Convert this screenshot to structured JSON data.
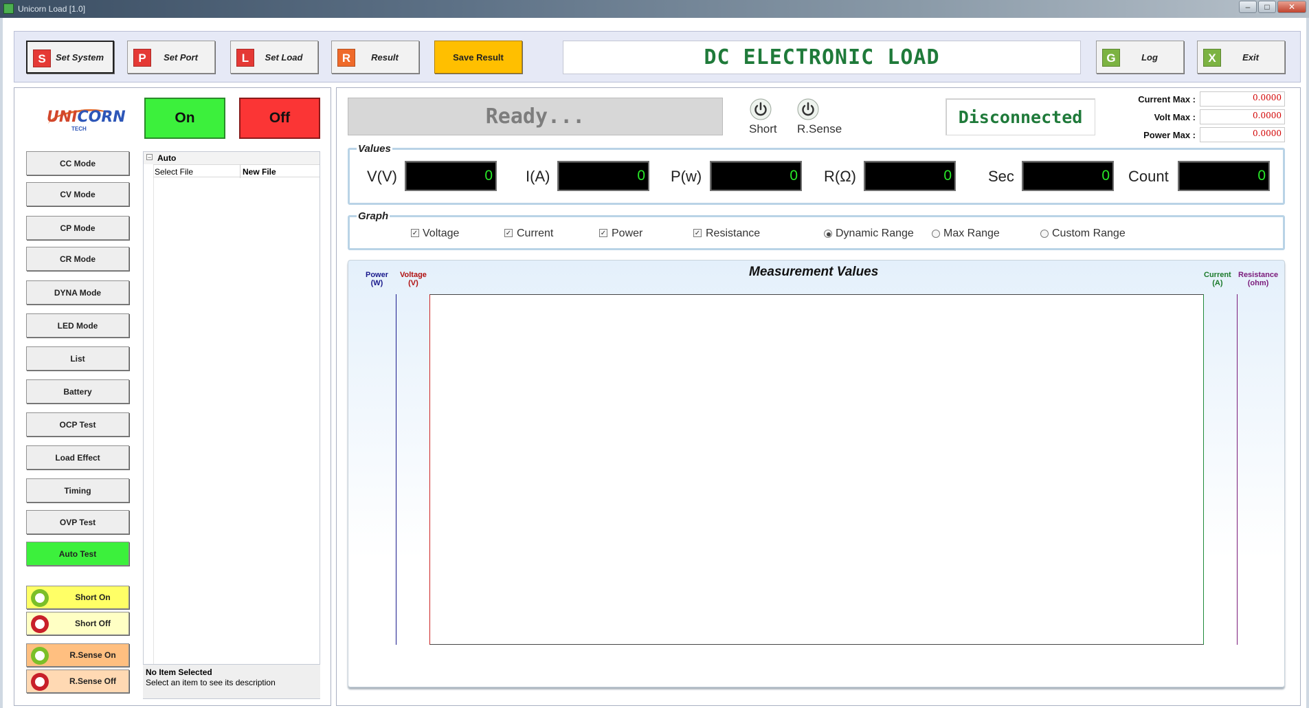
{
  "window": {
    "title": "Unicorn Load [1.0]"
  },
  "toolbar": {
    "set_system": {
      "icon": "S",
      "label": "Set System",
      "color": "#e53935"
    },
    "set_port": {
      "icon": "P",
      "label": "Set Port",
      "color": "#e53935"
    },
    "set_load": {
      "icon": "L",
      "label": "Set Load",
      "color": "#e53935"
    },
    "result": {
      "icon": "R",
      "label": "Result",
      "color": "#ef6a2a"
    },
    "save_result": {
      "label": "Save Result",
      "color": "#ffbf00"
    },
    "title": "DC ELECTRONIC LOAD",
    "log": {
      "icon": "G",
      "label": "Log",
      "color": "#7cb342"
    },
    "exit": {
      "icon": "X",
      "label": "Exit",
      "color": "#7cb342"
    }
  },
  "left": {
    "logo": {
      "text_a": "UNI",
      "text_b": "CORN",
      "sub": "TECH"
    },
    "on_label": "On",
    "off_label": "Off",
    "modes": [
      "CC Mode",
      "CV Mode",
      "CP Mode",
      "CR Mode",
      "DYNA Mode",
      "LED Mode",
      "List",
      "Battery",
      "OCP Test",
      "Load Effect",
      "Timing",
      "OVP Test",
      "Auto Test"
    ],
    "active_mode": "Auto Test",
    "short_on": "Short On",
    "short_off": "Short Off",
    "rsense_on": "R.Sense On",
    "rsense_off": "R.Sense Off",
    "tree": {
      "root": "Auto",
      "expander": "−",
      "row_label": "Select File",
      "row_value": "New File"
    },
    "description": {
      "title": "No Item Selected",
      "text": "Select an item to see its description"
    }
  },
  "right": {
    "ready_text": "Ready...",
    "short_label": "Short",
    "rsense_label": "R.Sense",
    "connection_status": "Disconnected",
    "max": {
      "current_label": "Current Max :",
      "current_value": "0.0000",
      "volt_label": "Volt Max :",
      "volt_value": "0.0000",
      "power_label": "Power Max :",
      "power_value": "0.0000"
    },
    "values_legend": "Values",
    "values": [
      {
        "label": "V(V)",
        "value": "0"
      },
      {
        "label": "I(A)",
        "value": "0"
      },
      {
        "label": "P(w)",
        "value": "0"
      },
      {
        "label": "R(Ω)",
        "value": "0"
      },
      {
        "label": "Sec",
        "value": "0"
      },
      {
        "label": "Count",
        "value": "0"
      }
    ],
    "graph_legend": "Graph",
    "graph_options": {
      "voltage": {
        "label": "Voltage",
        "checked": true
      },
      "current": {
        "label": "Current",
        "checked": true
      },
      "power": {
        "label": "Power",
        "checked": true
      },
      "resistance": {
        "label": "Resistance",
        "checked": true
      },
      "dynamic_range": {
        "label": "Dynamic Range",
        "selected": true
      },
      "max_range": {
        "label": "Max Range",
        "selected": false
      },
      "custom_range": {
        "label": "Custom Range",
        "selected": false
      }
    },
    "chart": {
      "title": "Measurement Values",
      "axes": {
        "power": {
          "name": "Power",
          "unit": "(W)",
          "color": "#1a1a8c"
        },
        "voltage": {
          "name": "Voltage",
          "unit": "(V)",
          "color": "#b01010"
        },
        "current": {
          "name": "Current",
          "unit": "(A)",
          "color": "#1a7a2a"
        },
        "resistance": {
          "name": "Resistance",
          "unit": "(ohm)",
          "color": "#7a1a7a"
        }
      }
    }
  }
}
